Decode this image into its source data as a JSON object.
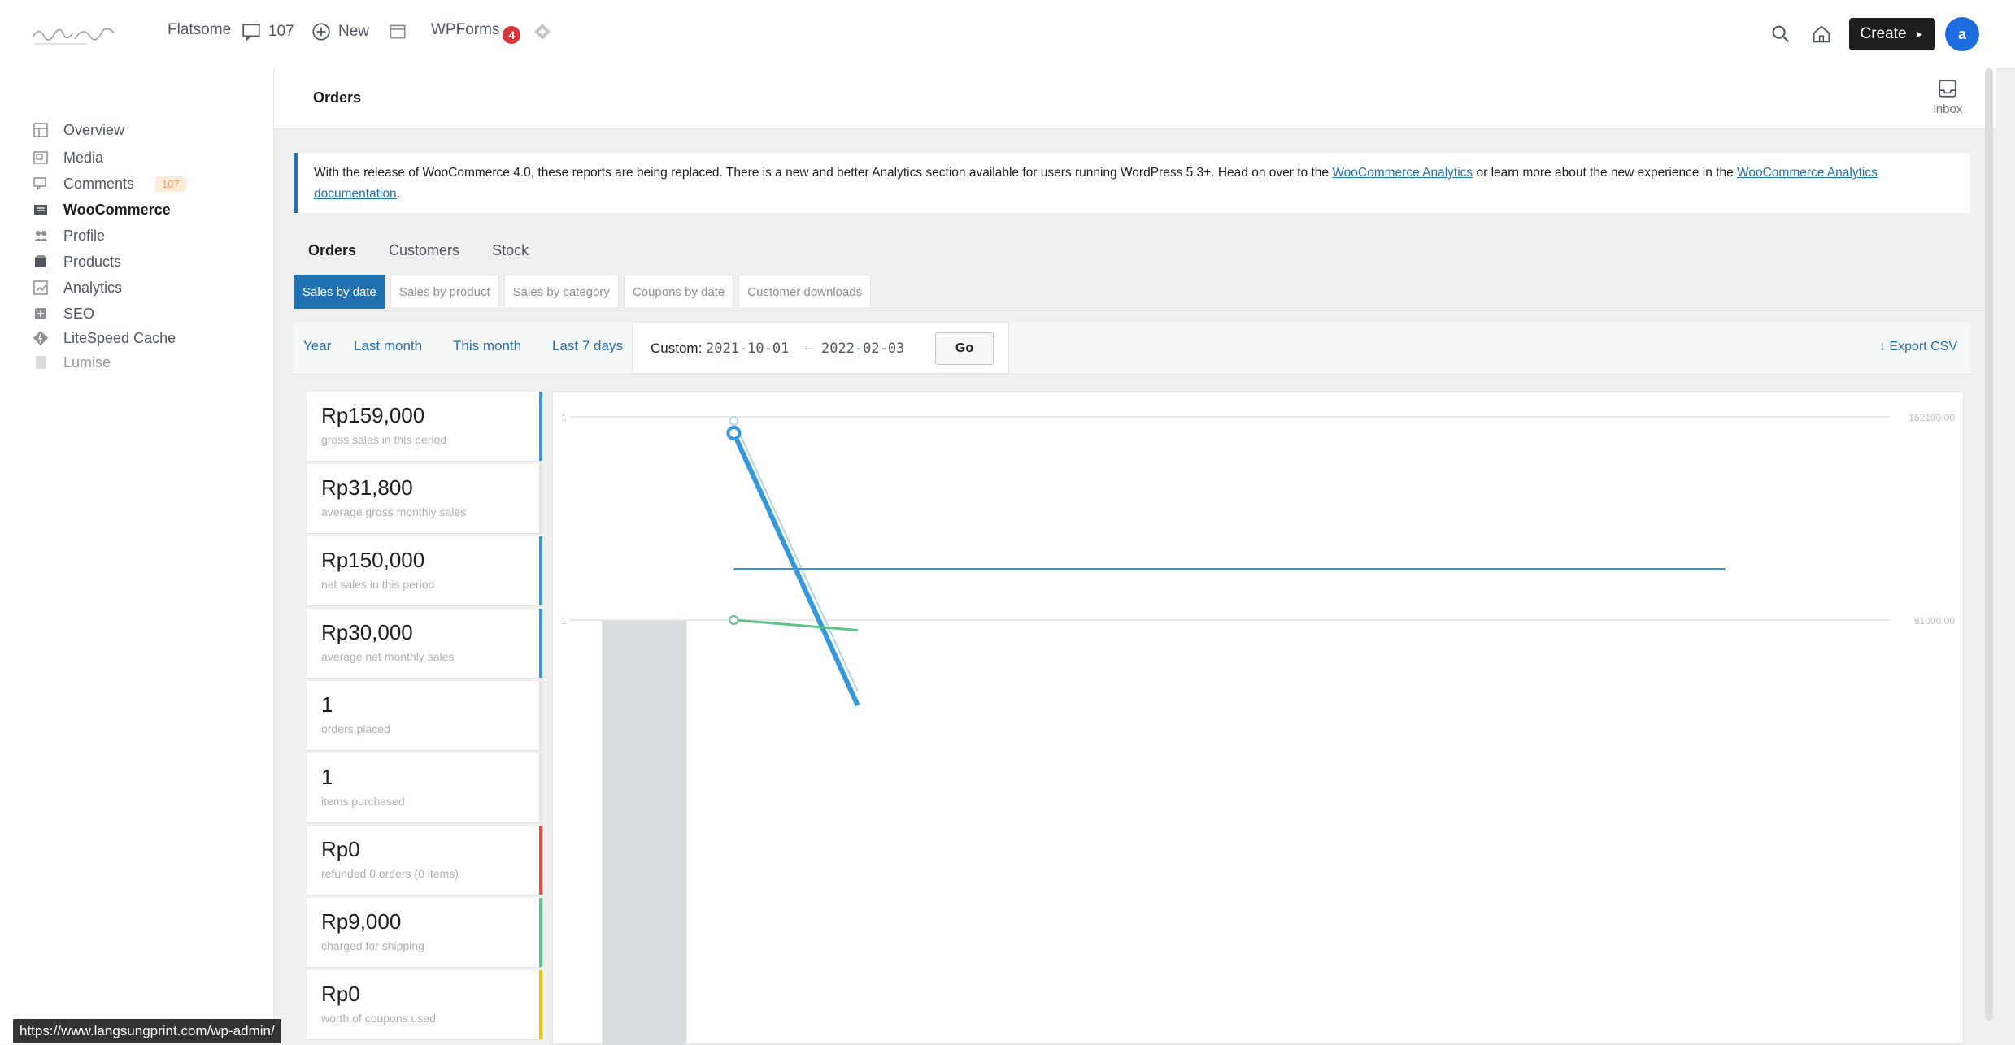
{
  "topbar": {
    "logo_alt": "",
    "site_name": "Flatsome",
    "comments_count": "107",
    "new_label": "New",
    "wpforms_label": "WPForms",
    "wpforms_badge": "4",
    "create_label": "Create",
    "avatar_initial": "a"
  },
  "sidebar": {
    "items": [
      {
        "label": "Overview",
        "icon": "overview-icon"
      },
      {
        "label": "Media",
        "icon": "media-icon"
      },
      {
        "label": "Comments",
        "icon": "comments-icon",
        "badge": "107"
      },
      {
        "label": "WooCommerce",
        "icon": "woocommerce-icon",
        "active": true
      },
      {
        "label": "Profile",
        "icon": "profile-icon"
      },
      {
        "label": "Products",
        "icon": "products-icon"
      },
      {
        "label": "Analytics",
        "icon": "analytics-icon"
      },
      {
        "label": "SEO",
        "icon": "seo-icon"
      },
      {
        "label": "LiteSpeed Cache",
        "icon": "litespeed-icon"
      },
      {
        "label": "Lumise",
        "icon": "lumise-icon"
      }
    ]
  },
  "header": {
    "title": "Orders",
    "inbox_label": "Inbox"
  },
  "notice": {
    "text_before": "With the release of WooCommerce 4.0, these reports are being replaced. There is a new and better Analytics section available for users running WordPress 5.3+. Head on over to the ",
    "link1": "WooCommerce Analytics",
    "text_middle": " or learn more about the new experience in the ",
    "link2": "WooCommerce Analytics documentation",
    "text_after": "."
  },
  "subnav": [
    "Orders",
    "Customers",
    "Stock"
  ],
  "report_tabs": [
    "Sales by date",
    "Sales by product",
    "Sales by category",
    "Coupons by date",
    "Customer downloads"
  ],
  "range": {
    "links": [
      "Year",
      "Last month",
      "This month",
      "Last 7 days"
    ],
    "custom_label": "Custom:",
    "date_from": "2021-10-01",
    "separator": "–",
    "date_to": "2022-02-03",
    "go_label": "Go",
    "export_label": "Export CSV"
  },
  "stats": [
    {
      "amount": "Rp159,000",
      "desc": "gross sales in this period",
      "color": "#3498db"
    },
    {
      "amount": "Rp31,800",
      "desc": "average gross monthly sales",
      "color": ""
    },
    {
      "amount": "Rp150,000",
      "desc": "net sales in this period",
      "color": "#3498db"
    },
    {
      "amount": "Rp30,000",
      "desc": "average net monthly sales",
      "color": "#3498db"
    },
    {
      "amount": "1",
      "desc": "orders placed",
      "color": ""
    },
    {
      "amount": "1",
      "desc": "items purchased",
      "color": ""
    },
    {
      "amount": "Rp0",
      "desc": "refunded 0 orders (0 items)",
      "color": "#e74c3c"
    },
    {
      "amount": "Rp9,000",
      "desc": "charged for shipping",
      "color": "#5cc488"
    },
    {
      "amount": "Rp0",
      "desc": "worth of coupons used",
      "color": "#f1c40f"
    }
  ],
  "chart_data": {
    "type": "line",
    "left_ticks": [
      "1",
      "1"
    ],
    "right_ticks": [
      "152100.00",
      "81000.00"
    ],
    "series": [
      {
        "color": "#b1d4ea",
        "points": [
          [
            1,
            0.98
          ],
          [
            2,
            -0.35
          ]
        ]
      },
      {
        "color": "#3498db",
        "points": [
          [
            1,
            0.92
          ],
          [
            2,
            -0.42
          ]
        ]
      },
      {
        "color": "#3498db",
        "points": [
          [
            1,
            0.25
          ],
          [
            9,
            0.25
          ]
        ]
      },
      {
        "color": "#5cc488",
        "points": [
          [
            1,
            0.0
          ],
          [
            2,
            -0.05
          ]
        ]
      }
    ],
    "highlight_band": [
      0.2,
      1.1
    ],
    "ylim": [
      0,
      1
    ],
    "xlim": [
      0,
      10
    ]
  },
  "status_url": "https://www.langsungprint.com/wp-admin/"
}
